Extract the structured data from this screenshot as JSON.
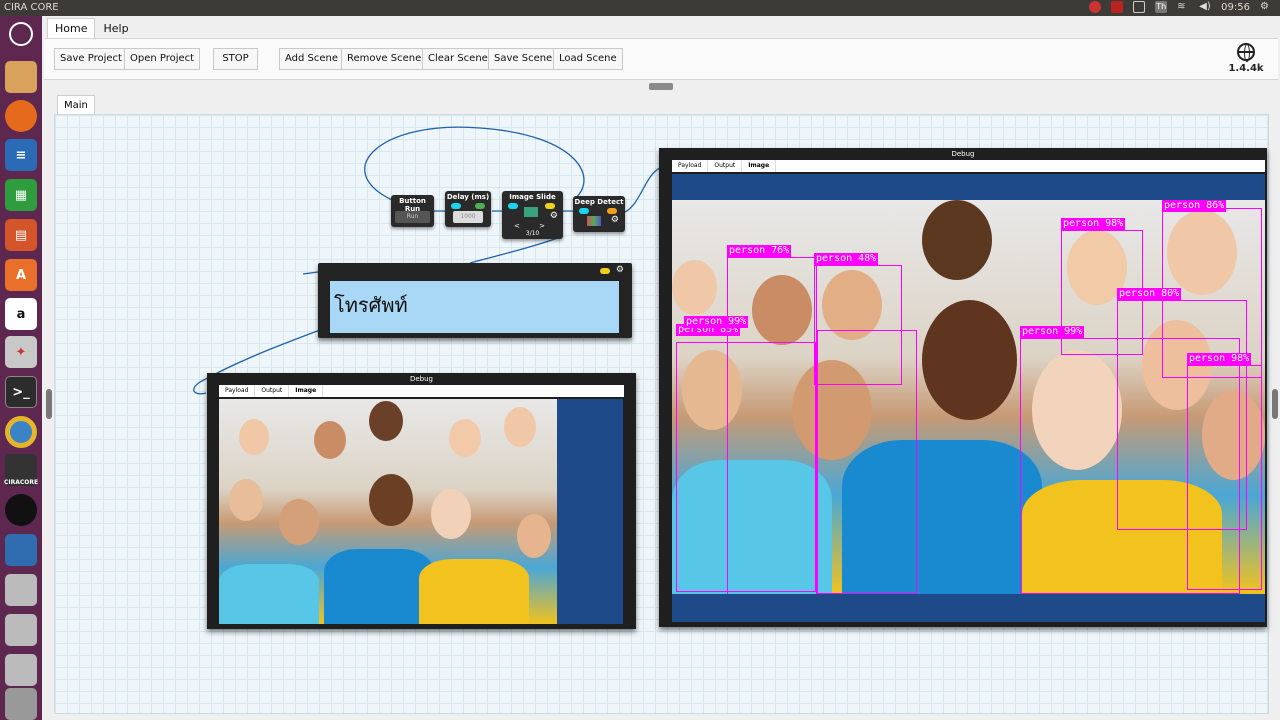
{
  "window": {
    "title": "CIRA CORE",
    "clock": "09:56"
  },
  "menu": {
    "tabs": [
      "Home",
      "Help"
    ]
  },
  "toolbar": {
    "save_project": "Save Project",
    "open_project": "Open Project",
    "stop": "STOP",
    "add_scene": "Add Scene",
    "remove_scene": "Remove Scene",
    "clear_scene": "Clear Scene",
    "save_scene": "Save Scene",
    "load_scene": "Load Scene"
  },
  "version_label": "1.4.4k",
  "page_tab": "Main",
  "nodes": {
    "button_run": {
      "title": "Button Run",
      "button": "Run"
    },
    "delay": {
      "title": "Delay (ms)",
      "value": "1000"
    },
    "image_slide": {
      "title": "Image Slide",
      "counter": "3/10",
      "prev": "<",
      "next": ">"
    },
    "deep_detect": {
      "title": "Deep Detect"
    }
  },
  "text_node": {
    "text": "โทรศัพท์"
  },
  "debug_small": {
    "title": "Debug",
    "tabs": [
      "Payload",
      "Output",
      "Image"
    ],
    "active_tab": "Image"
  },
  "debug_large": {
    "title": "Debug",
    "tabs": [
      "Payload",
      "Output",
      "Image"
    ],
    "active_tab": "Image"
  },
  "detections": [
    {
      "label": "person 76%"
    },
    {
      "label": "person 48%"
    },
    {
      "label": "person 98%"
    },
    {
      "label": "person 86%"
    },
    {
      "label": "person 80%"
    },
    {
      "label": "person 99%"
    },
    {
      "label": "person 85%"
    },
    {
      "label": "person 99%"
    },
    {
      "label": "person 98%"
    }
  ],
  "colors": {
    "accent_bbox": "#ff00ff",
    "launcher": "#5e2750",
    "debug_bar": "#1f4a8a"
  }
}
